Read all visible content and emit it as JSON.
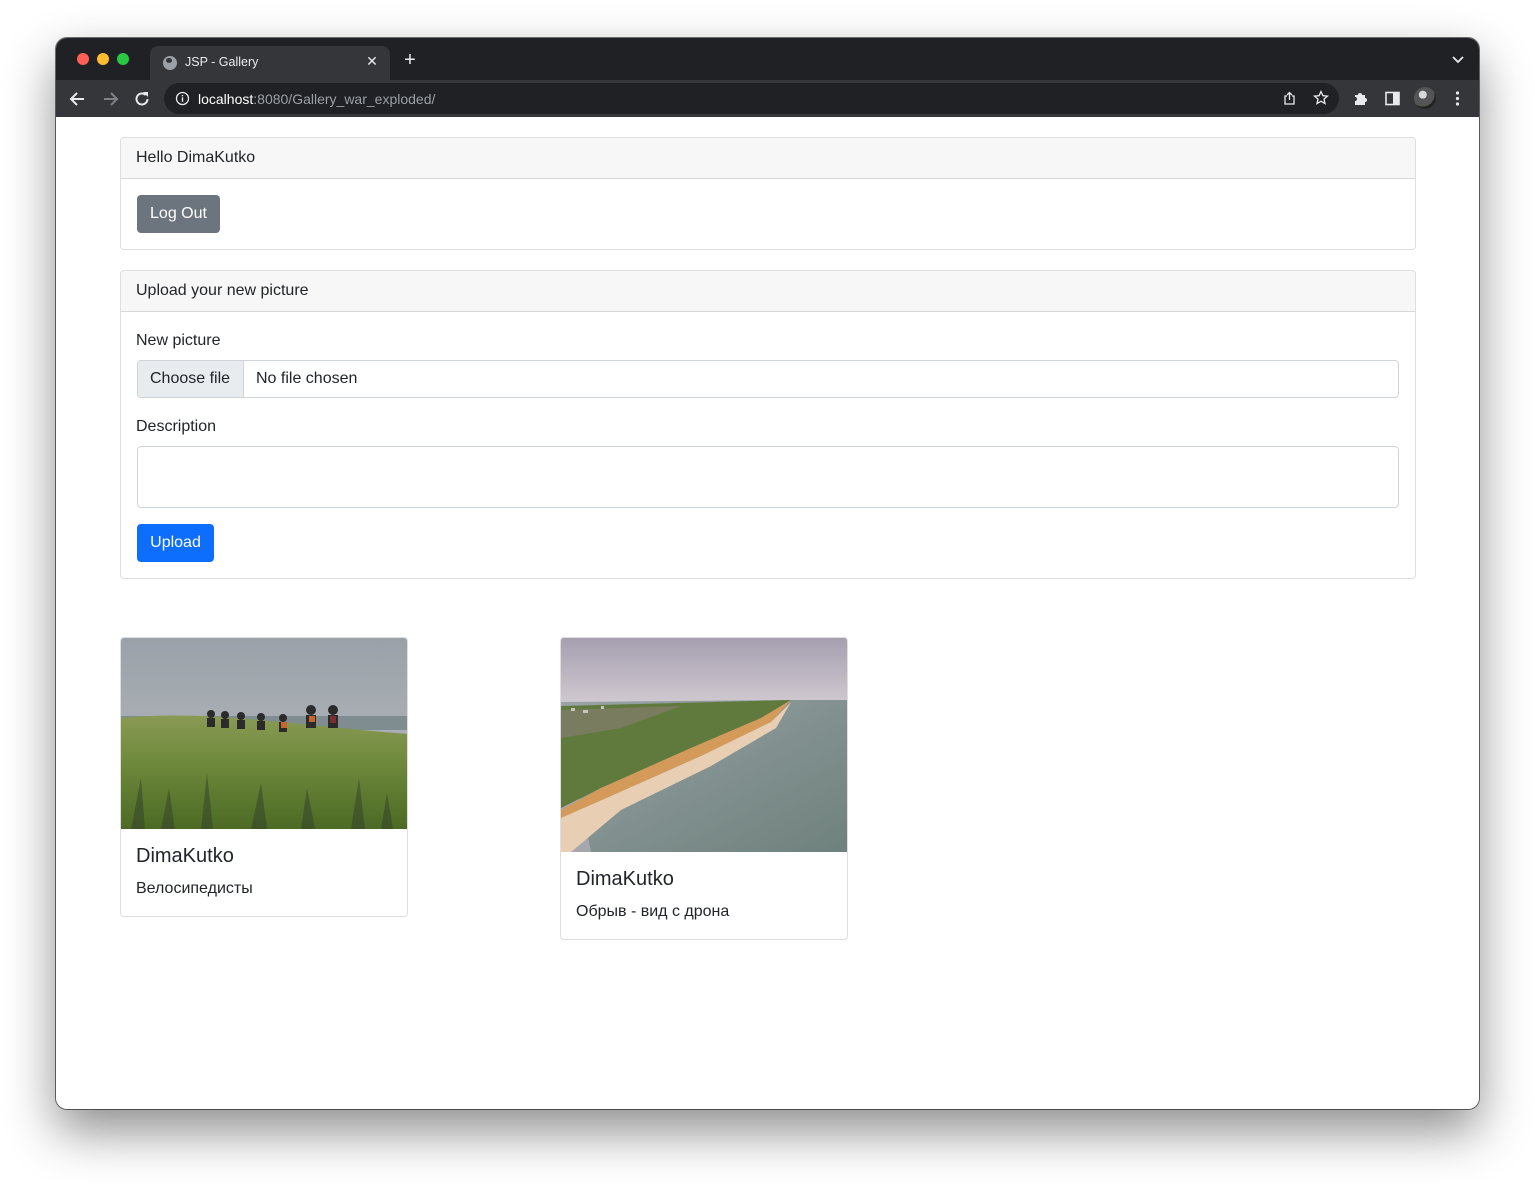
{
  "browser": {
    "tab_title": "JSP - Gallery",
    "tab_close": "✕",
    "new_tab": "+",
    "url_host": "localhost",
    "url_rest": ":8080/Gallery_war_exploded/"
  },
  "greeting": {
    "header": "Hello DimaKutko",
    "logout_label": "Log Out"
  },
  "upload": {
    "header": "Upload your new picture",
    "picture_label": "New picture",
    "choose_file_label": "Choose file",
    "file_status": "No file chosen",
    "description_label": "Description",
    "description_value": "",
    "upload_label": "Upload"
  },
  "gallery": [
    {
      "author": "DimaKutko",
      "description": "Велосипедисты",
      "image": "cyclists-on-grassy-coastal-hill"
    },
    {
      "author": "DimaKutko",
      "description": "Обрыв - вид с дрона",
      "image": "aerial-cliff-coastline"
    }
  ],
  "colors": {
    "primary": "#0d6efd",
    "secondary": "#6c757d"
  }
}
